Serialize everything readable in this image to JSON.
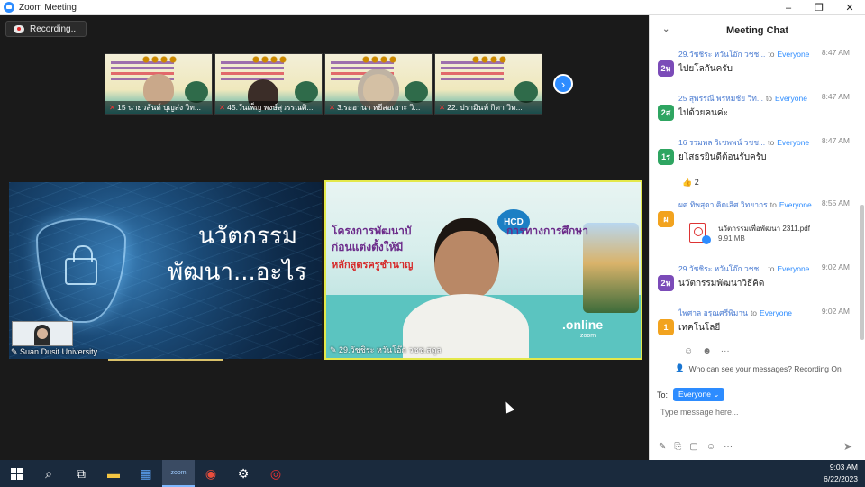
{
  "window": {
    "title": "Zoom Meeting",
    "controls": [
      "–",
      "❐",
      "✕"
    ]
  },
  "recording": {
    "label": "Recording..."
  },
  "gallery": {
    "thumbnails": [
      {
        "name": "15 นายวสันต์ บุญส่ง วิท..."
      },
      {
        "name": "45.วันเพ็ญ พงษ์สุวรรณศิ..."
      },
      {
        "name": "3.รอฮานา หยีสอเฮาะ วิ..."
      },
      {
        "name": "22. ปรามินท์  กิตา  วิท..."
      }
    ],
    "next_icon": "chevron-right-icon"
  },
  "share_tile": {
    "slide_line1": "นวัตกรรม",
    "slide_line2": "พัฒนา...อะไร",
    "name": "Suan Dusit University"
  },
  "speaker_tile": {
    "slide_title_left": "โครงการพัฒนาบั",
    "slide_title_right": "การทางการศึกษา",
    "slide_title_line2": "ก่อนแต่งตั้งให้มี",
    "slide_subtitle": "หลักสูตรครูชำนาญ",
    "logo": "HCD",
    "online": ".online",
    "zoom_label": "zoom",
    "name": "29.วัชชิระ หวันโอ๊ก วชช.สตูล"
  },
  "chat": {
    "title": "Meeting Chat",
    "messages": [
      {
        "avatar": "2ห",
        "avatar_color": "#7b4bb8",
        "sender": "29.วัชชิระ หวันโอ๊ก วชช...",
        "to": "to",
        "recipient": "Everyone",
        "time": "8:47 AM",
        "text": "ไปยโลกันครับ"
      },
      {
        "avatar": "2ส",
        "avatar_color": "#2ea561",
        "sender": "25 สุพรรณี  พรหมชัย วิท...",
        "to": "to",
        "recipient": "Everyone",
        "time": "8:47 AM",
        "text": "ไปด้วยคนค่ะ"
      },
      {
        "avatar": "1ร",
        "avatar_color": "#2ea561",
        "sender": "16 รวมพล วิเชพพน์ วชช...",
        "to": "to",
        "recipient": "Everyone",
        "time": "8:47 AM",
        "text": "ยโสธรยินดีต้อนรับครับ"
      },
      {
        "avatar": "ผ",
        "avatar_color": "#f2a31f",
        "sender": "ผศ.ทิพสุดา คิดเลิศ วิทยากร",
        "to": "to",
        "recipient": "Everyone",
        "time": "8:55 AM",
        "text": ""
      },
      {
        "avatar": "2ห",
        "avatar_color": "#7b4bb8",
        "sender": "29.วัชชิระ หวันโอ๊ก วชช...",
        "to": "to",
        "recipient": "Everyone",
        "time": "9:02 AM",
        "text": "นวัตกรรมพัฒนาวิธีคิด"
      },
      {
        "avatar": "1",
        "avatar_color": "#f2a31f",
        "sender": "ไพศาล อรุณศรีพิมาน",
        "to": "to",
        "recipient": "Everyone",
        "time": "9:02 AM",
        "text": "เทคโนโลยี"
      }
    ],
    "reaction": {
      "emoji": "👍",
      "count": "2"
    },
    "file": {
      "name": "นวัตกรรมเพื่อพัฒนา 2311.pdf",
      "size": "9.91 MB"
    },
    "msg_tools": [
      "☺",
      "☻",
      "···"
    ],
    "privacy_text": "Who can see your messages? Recording On",
    "to_label": "To:",
    "to_value": "Everyone",
    "input_placeholder": "Type message here...",
    "toolbar": [
      "✎",
      "⎘",
      "▢",
      "☺",
      "···"
    ],
    "send_icon": "➤"
  },
  "taskbar": {
    "items": [
      {
        "icon": "windows-start-icon"
      },
      {
        "icon": "search-icon",
        "glyph": "⌕"
      },
      {
        "icon": "task-view-icon",
        "glyph": "⧉"
      },
      {
        "icon": "file-explorer-icon",
        "glyph": "▬"
      },
      {
        "icon": "app-grid-icon",
        "glyph": "▦"
      },
      {
        "icon": "zoom-icon",
        "glyph": "zoom"
      },
      {
        "icon": "chrome-icon",
        "glyph": "◉"
      },
      {
        "icon": "settings-icon",
        "glyph": "⚙"
      },
      {
        "icon": "app-red-icon",
        "glyph": "◎"
      }
    ],
    "time": "9:03 AM",
    "date": "6/22/2023"
  }
}
